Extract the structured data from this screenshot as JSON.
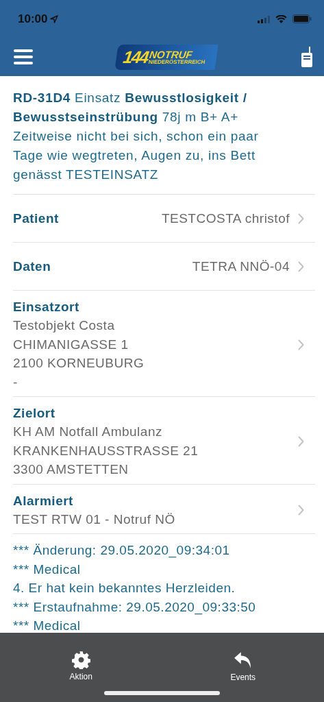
{
  "status_bar": {
    "time": "10:00"
  },
  "nav_bar": {
    "logo": {
      "number": "144",
      "word": "NOTRUF",
      "region": "NIEDERÖSTERREICH"
    }
  },
  "summary": "**RD-31D4** Einsatz **Bewusstlosigkeit / Bewusstseinstrübung** 78j m B+ A+ Zeitweise nicht bei sich, schon ein paar Tage wie wegtreten, Augen zu, ins Bett genässt TESTEINSATZ",
  "rows": [
    {
      "kind": "inline",
      "label": "Patient",
      "value": "TESTCOSTA christof"
    },
    {
      "kind": "inline",
      "label": "Daten",
      "value": "TETRA NNÖ-04"
    },
    {
      "kind": "stacked",
      "label": "Einsatzort",
      "lines": [
        "Testobjekt Costa",
        "CHIMANIGASSE  1",
        "2100 KORNEUBURG",
        "-"
      ]
    },
    {
      "kind": "stacked",
      "label": "Zielort",
      "lines": [
        "KH AM Notfall Ambulanz",
        "KRANKENHAUSSTRASSE  21",
        "3300 AMSTETTEN"
      ]
    },
    {
      "kind": "stacked",
      "label": "Alarmiert",
      "lines": [
        "TEST RTW 01 - Notruf NÖ"
      ]
    }
  ],
  "notes": [
    "*** Änderung: 29.05.2020_09:34:01",
    "*** Medical",
    "4. Er hat kein bekanntes Herzleiden.",
    "*** Erstaufnahme: 29.05.2020_09:33:50",
    "*** Medical"
  ],
  "tab_bar": [
    {
      "kind": "gear",
      "label": "Aktion"
    },
    {
      "kind": "reply",
      "label": "Events"
    }
  ]
}
